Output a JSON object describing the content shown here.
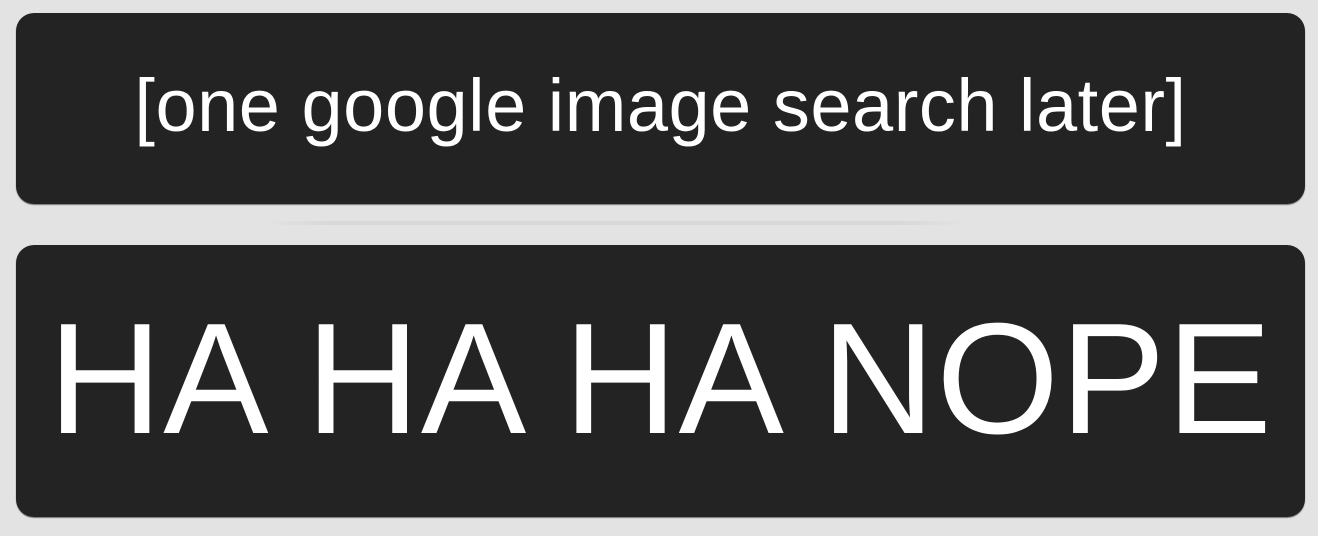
{
  "panels": [
    {
      "text": "[one google image search later]"
    },
    {
      "text": "HA HA HA NOPE"
    }
  ],
  "colors": {
    "background": "#e3e3e3",
    "panel": "#232323",
    "text": "#ffffff"
  }
}
